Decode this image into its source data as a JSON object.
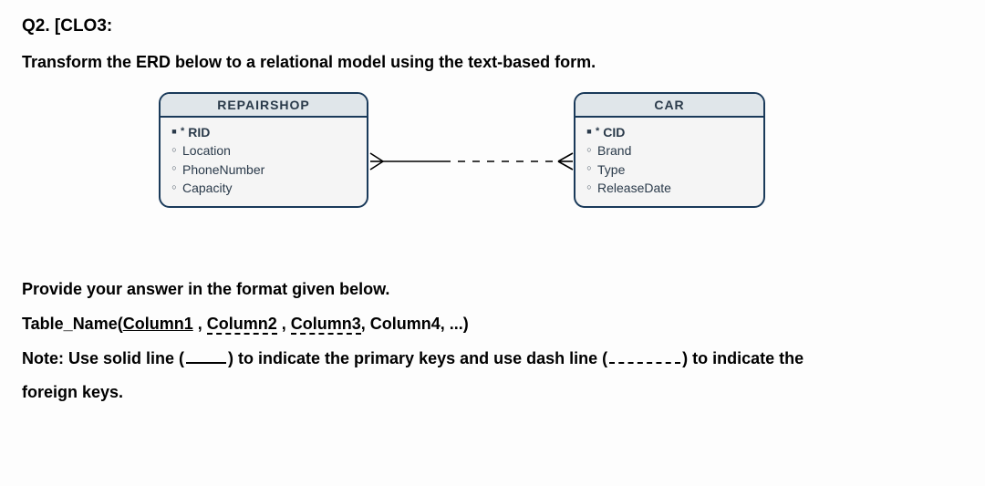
{
  "question": {
    "header": "Q2. [CLO3:",
    "prompt": "Transform the ERD below to a relational model using the text-based form."
  },
  "erd": {
    "left_entity": {
      "title": "REPAIRSHOP",
      "pk": "RID",
      "attrs": [
        "Location",
        "PhoneNumber",
        "Capacity"
      ]
    },
    "right_entity": {
      "title": "CAR",
      "pk": "CID",
      "attrs": [
        "Brand",
        "Type",
        "ReleaseDate"
      ]
    }
  },
  "answer_instructions": {
    "line1": "Provide your answer in the format given below.",
    "format_prefix": "Table_Name(",
    "col1": "Column1",
    "sep": " , ",
    "col2": "Column2",
    "col3": "Column3",
    "col4_suffix": ", Column4, ...)",
    "note_prefix": "Note: Use solid line (",
    "note_mid": ") to indicate the primary keys and use dash line (",
    "note_suffix": ") to indicate the",
    "note_line2": "foreign keys."
  }
}
